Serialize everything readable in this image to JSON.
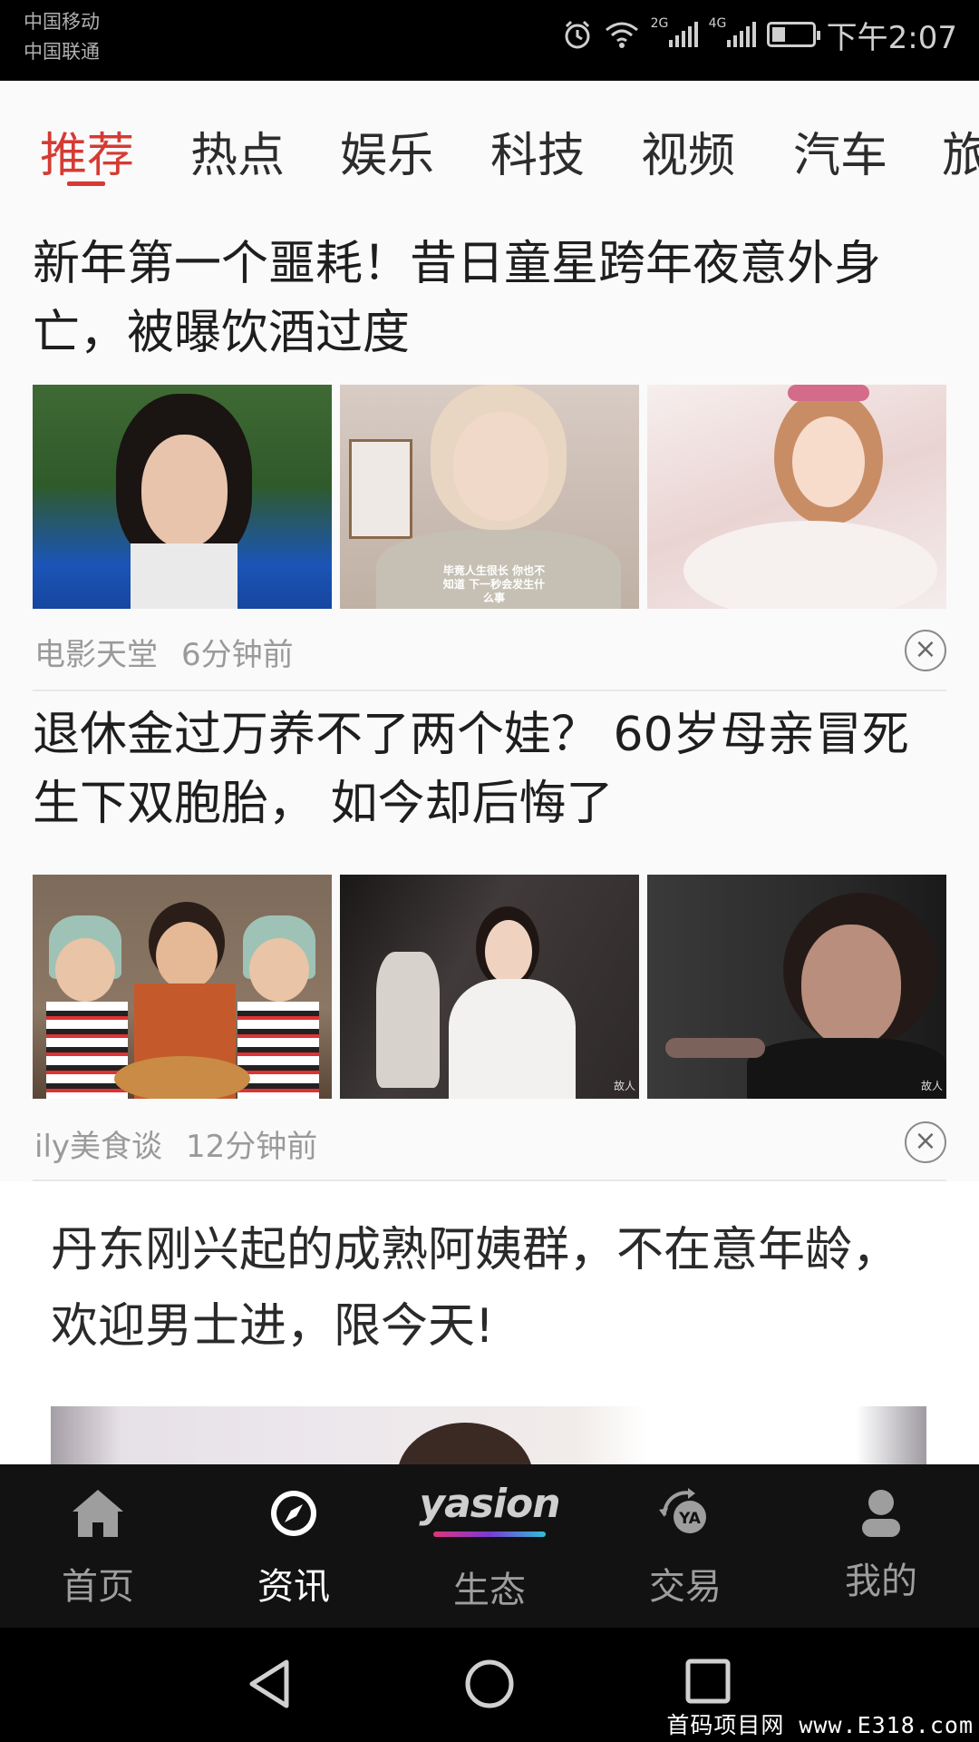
{
  "status_bar": {
    "carrier_1": "中国移动",
    "carrier_2": "中国联通",
    "sim1_network": "2G",
    "sim2_network": "4G",
    "time": "下午2:07",
    "battery_level": 0.35,
    "icons": [
      "alarm-icon",
      "wifi-icon",
      "signal-icon",
      "battery-icon"
    ]
  },
  "tabs": [
    {
      "label": "推荐",
      "active": true
    },
    {
      "label": "热点"
    },
    {
      "label": "娱乐"
    },
    {
      "label": "科技"
    },
    {
      "label": "视频"
    },
    {
      "label": "汽车"
    },
    {
      "label": "旅"
    }
  ],
  "articles": [
    {
      "title": "新年第一个噩耗！昔日童星跨年夜意外身亡，被曝饮酒过度",
      "source": "电影天堂",
      "time": "6分钟前",
      "image_caption": "毕竟人生很长 你也不知道 下一秒会发生什么事"
    },
    {
      "title": "退休金过万养不了两个娃？ 60岁母亲冒死生下双胞胎， 如今却后悔了",
      "source": "ily美食谈",
      "time": "12分钟前",
      "image_watermark": "故人"
    }
  ],
  "ad": {
    "title": "丹东刚兴起的成熟阿姨群，不在意年龄，欢迎男士进，限今天!"
  },
  "bottom_nav": [
    {
      "label": "首页",
      "icon": "home-icon"
    },
    {
      "label": "资讯",
      "icon": "compass-icon",
      "active": true
    },
    {
      "label": "生态",
      "logo": "yasion"
    },
    {
      "label": "交易",
      "icon": "exchange-icon"
    },
    {
      "label": "我的",
      "icon": "user-icon"
    }
  ],
  "watermark": "首码项目网 www.E318.com",
  "colors": {
    "accent": "#d43b33",
    "nav_bg": "#121212",
    "feed_bg": "#fafafa"
  }
}
